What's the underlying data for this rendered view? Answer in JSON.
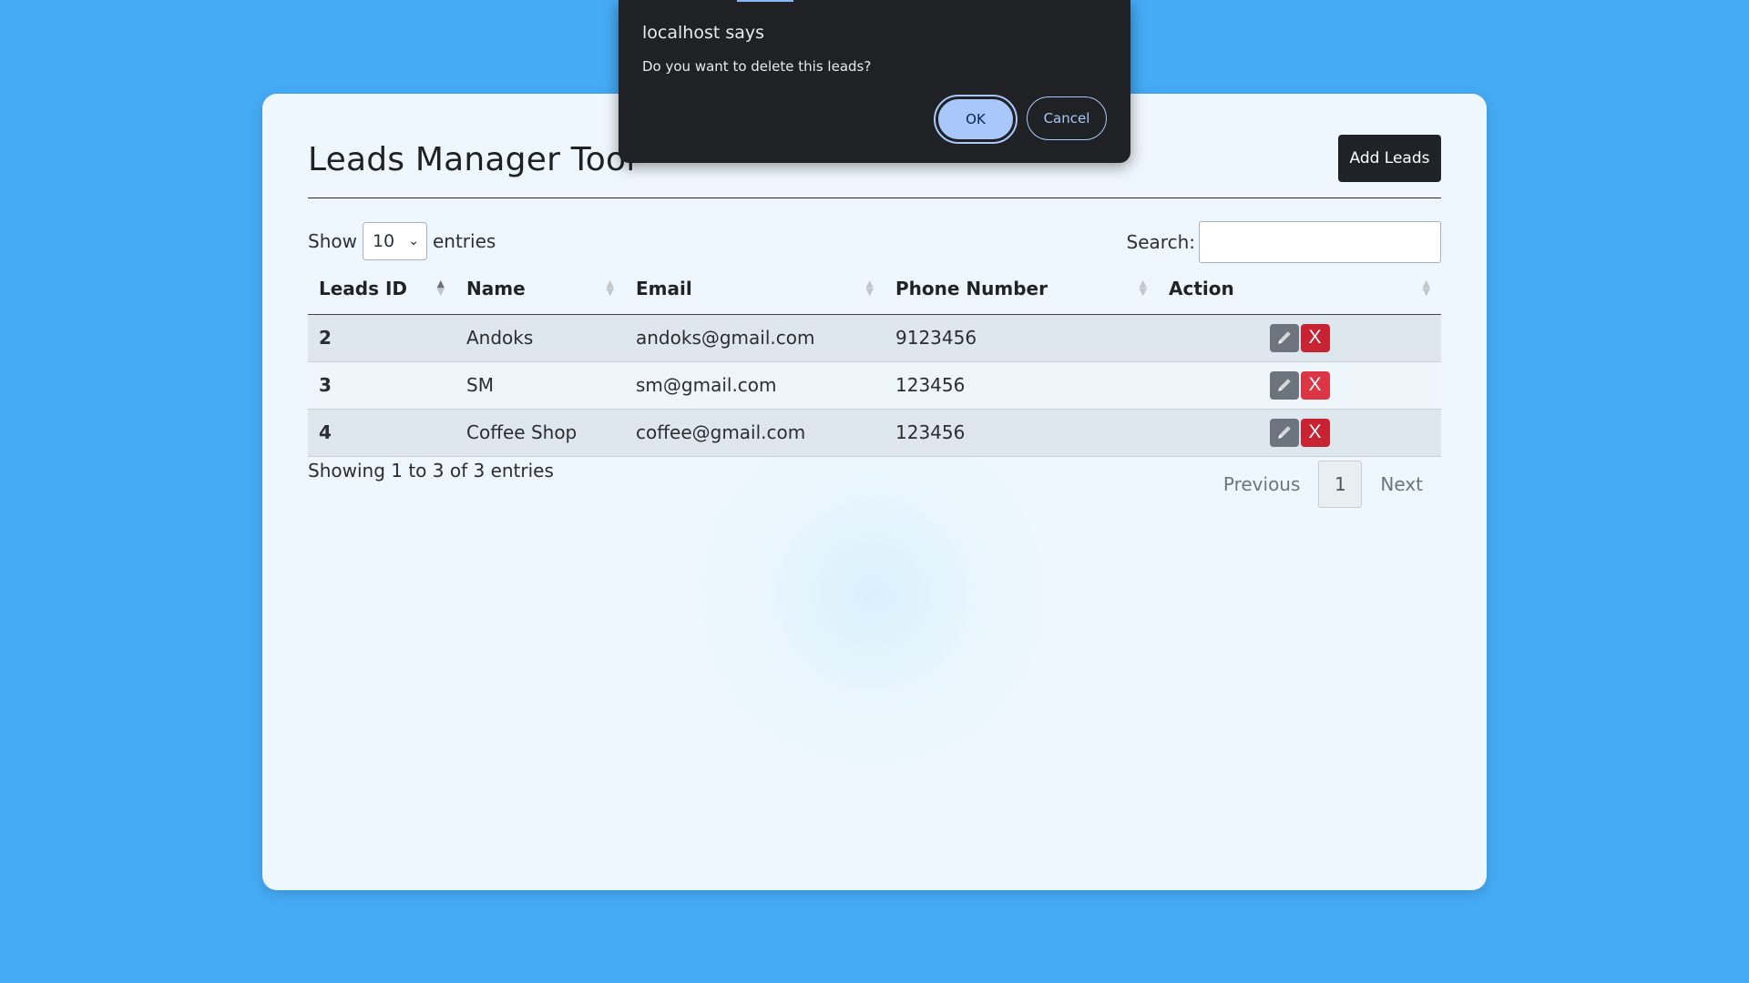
{
  "page": {
    "title": "Leads Manager Tool",
    "add_button": "Add Leads"
  },
  "table_controls": {
    "show_label": "Show",
    "entries_value": "10",
    "entries_label": "entries",
    "search_label": "Search:",
    "search_value": ""
  },
  "table": {
    "headers": [
      "Leads ID",
      "Name",
      "Email",
      "Phone Number",
      "Action"
    ],
    "rows": [
      {
        "id": "2",
        "name": "Andoks",
        "email": "andoks@gmail.com",
        "phone": "9123456"
      },
      {
        "id": "3",
        "name": "SM",
        "email": "sm@gmail.com",
        "phone": "123456"
      },
      {
        "id": "4",
        "name": "Coffee Shop",
        "email": "coffee@gmail.com",
        "phone": "123456"
      }
    ],
    "delete_label": "X"
  },
  "footer": {
    "info": "Showing 1 to 3 of 3 entries",
    "prev": "Previous",
    "page": "1",
    "next": "Next"
  },
  "dialog": {
    "title": "localhost says",
    "message": "Do you want to delete this leads?",
    "ok": "OK",
    "cancel": "Cancel"
  },
  "colors": {
    "background": "#45abf5",
    "card": "#eef7fd",
    "danger": "#dc3545",
    "secondary": "#6c757d",
    "dark": "#1f2327"
  }
}
